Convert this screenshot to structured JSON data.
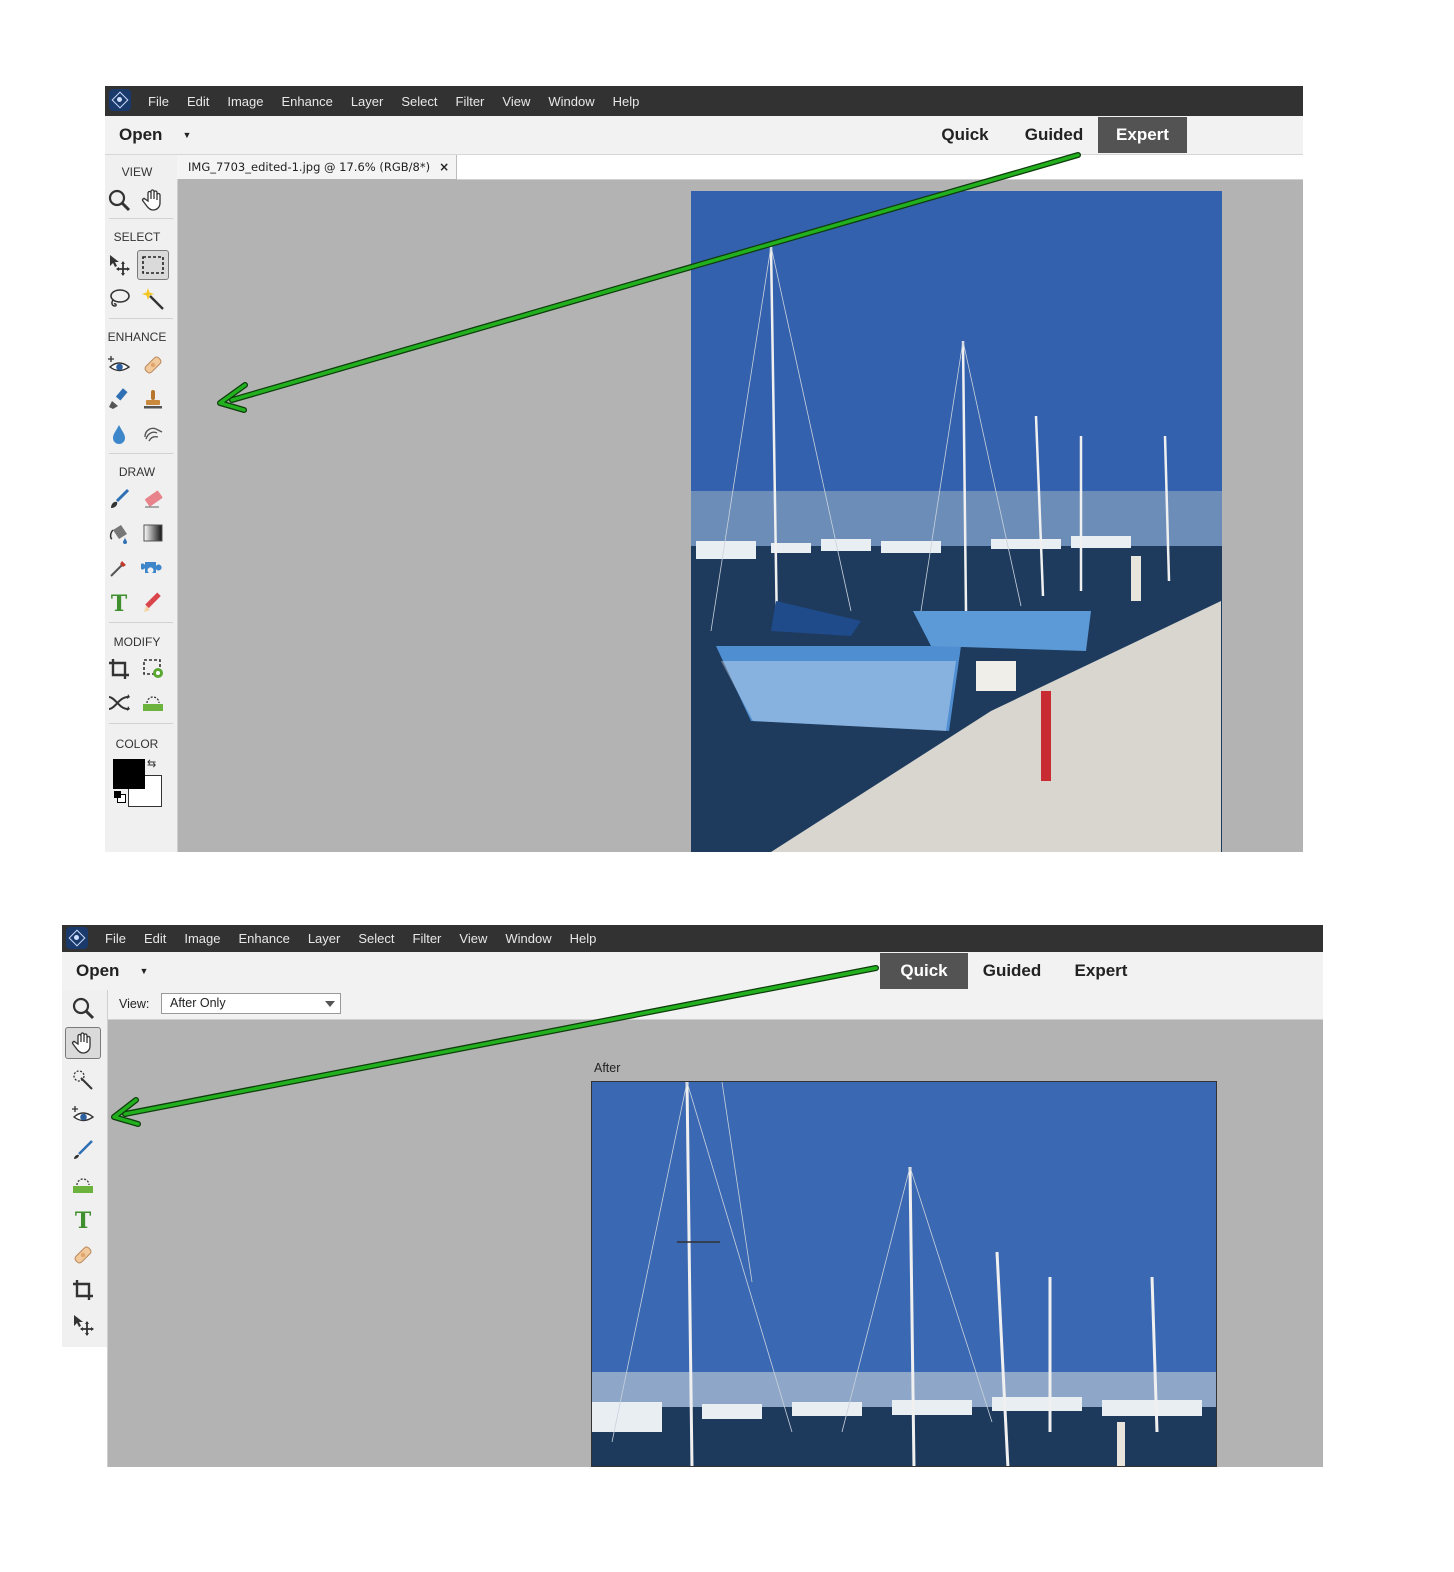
{
  "menu_items": [
    "File",
    "Edit",
    "Image",
    "Enhance",
    "Layer",
    "Select",
    "Filter",
    "View",
    "Window",
    "Help"
  ],
  "open_label": "Open",
  "modes": {
    "quick": "Quick",
    "guided": "Guided",
    "expert": "Expert"
  },
  "screenshot1": {
    "active_mode": "Expert",
    "document_tab": "IMG_7703_edited-1.jpg @ 17.6% (RGB/8*)",
    "tab_close": "×",
    "sections": {
      "view": "VIEW",
      "select": "SELECT",
      "enhance": "ENHANCE",
      "draw": "DRAW",
      "modify": "MODIFY",
      "color": "COLOR"
    },
    "tools": {
      "view": [
        "zoom-tool-icon",
        "hand-tool-icon"
      ],
      "select": [
        "move-tool-icon",
        "rectangular-marquee-icon",
        "lasso-tool-icon",
        "magic-wand-icon"
      ],
      "enhance": [
        "red-eye-removal-icon",
        "spot-healing-brush-icon",
        "smart-brush-icon",
        "clone-stamp-icon",
        "blur-tool-icon",
        "smudge-tool-icon"
      ],
      "draw": [
        "brush-tool-icon",
        "eraser-tool-icon",
        "paint-bucket-icon",
        "gradient-tool-icon",
        "eyedropper-tool-icon",
        "custom-shape-icon",
        "type-tool-icon",
        "pencil-tool-icon"
      ],
      "modify": [
        "crop-tool-icon",
        "recompose-tool-icon",
        "content-aware-move-icon",
        "straighten-tool-icon"
      ]
    },
    "colors": {
      "foreground": "#000000",
      "background": "#ffffff"
    }
  },
  "screenshot2": {
    "active_mode": "Quick",
    "view_label": "View:",
    "view_selected": "After Only",
    "after_label": "After",
    "tools": [
      "zoom-tool-icon",
      "hand-tool-icon",
      "quick-selection-icon",
      "red-eye-removal-icon",
      "whiten-teeth-icon",
      "straighten-tool-icon",
      "type-tool-icon",
      "spot-healing-brush-icon",
      "crop-tool-icon",
      "move-tool-icon"
    ]
  },
  "annotation_arrow_color": "#22b01e"
}
